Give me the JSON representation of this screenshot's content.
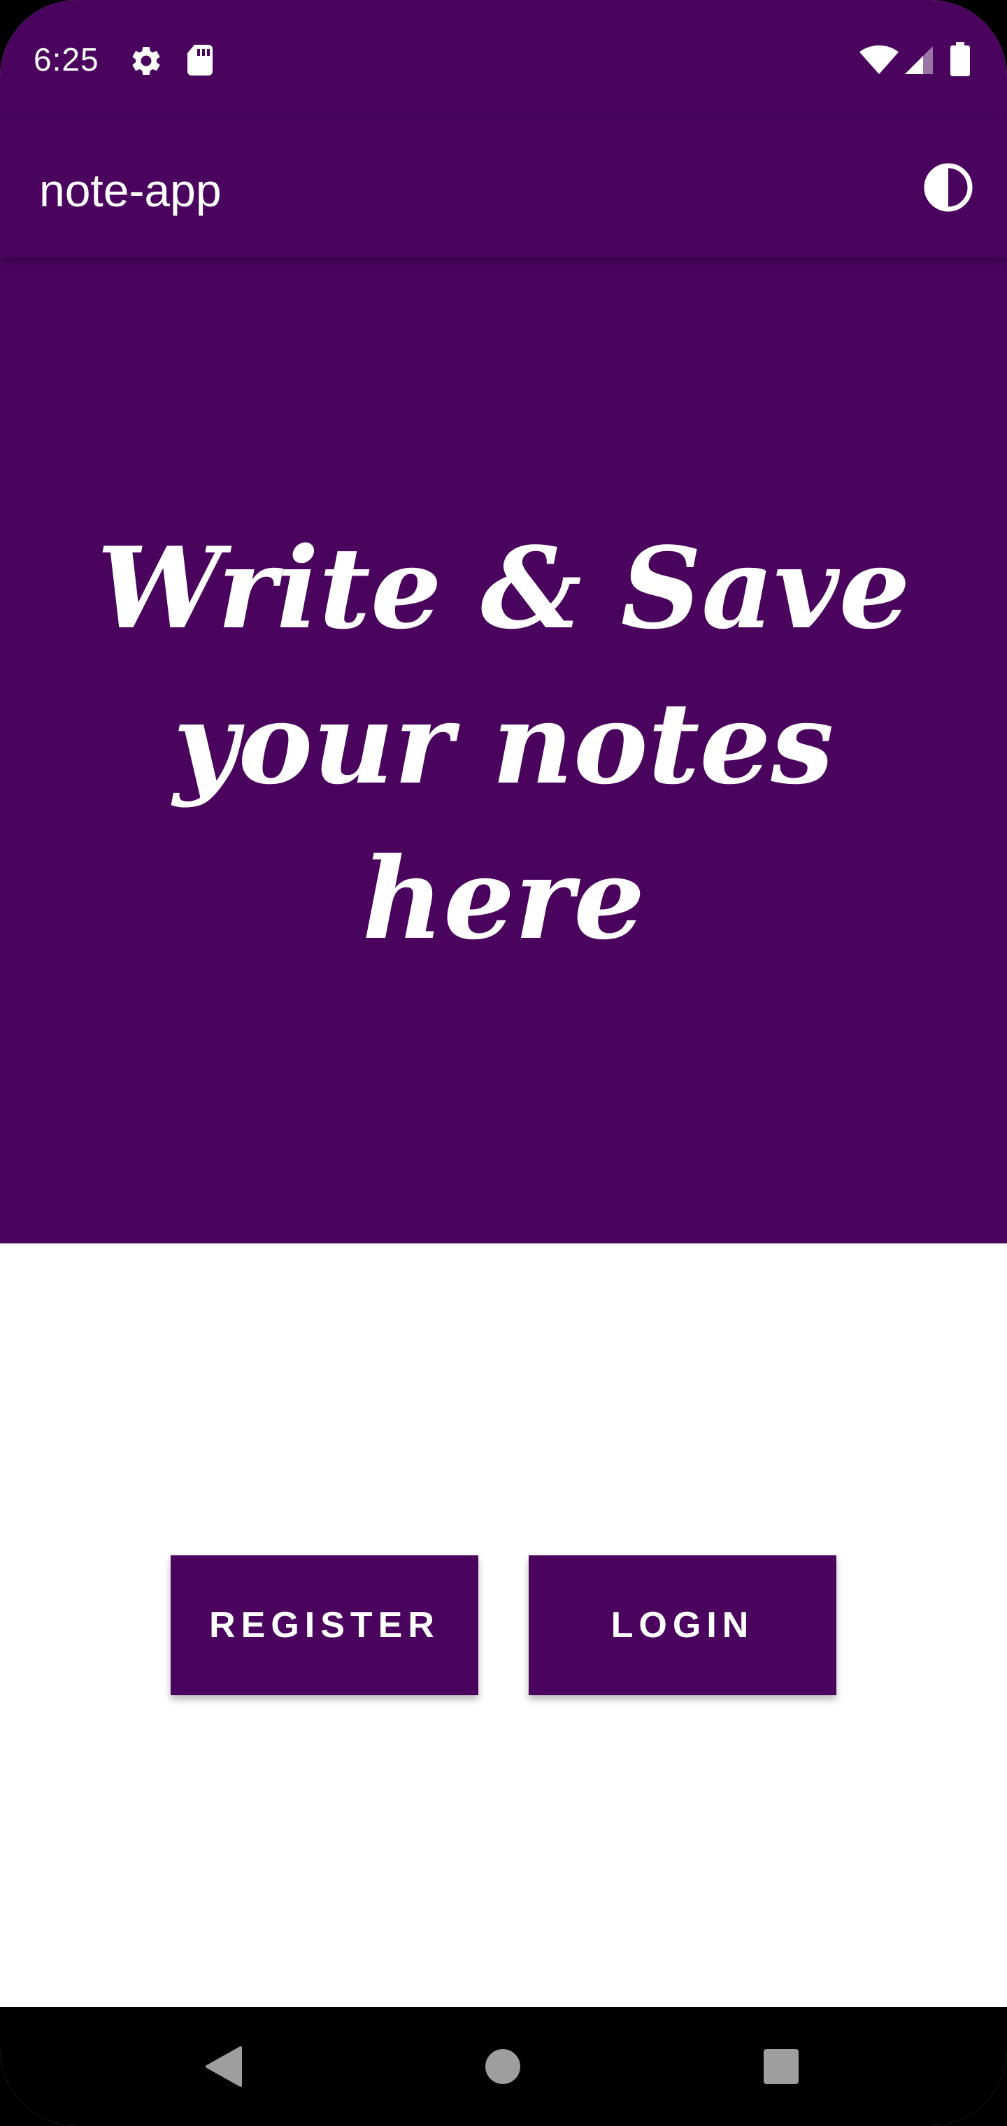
{
  "status_bar": {
    "time": "6:25",
    "icons": [
      "settings-gear-icon",
      "sd-card-icon",
      "wifi-icon",
      "cell-signal-icon",
      "battery-icon"
    ]
  },
  "app_bar": {
    "title": "note-app",
    "theme_toggle_icon": "contrast-icon"
  },
  "hero": {
    "headline": "Write & Save your notes here"
  },
  "actions": {
    "register_label": "REGISTER",
    "login_label": "LOGIN"
  },
  "nav_bar": {
    "icons": [
      "back-icon",
      "home-icon",
      "recents-icon"
    ]
  },
  "colors": {
    "primary": "#4a045e",
    "on_primary": "#ffffff",
    "background": "#ffffff",
    "nav_background": "#000000",
    "nav_icon": "#9e9e9e"
  }
}
